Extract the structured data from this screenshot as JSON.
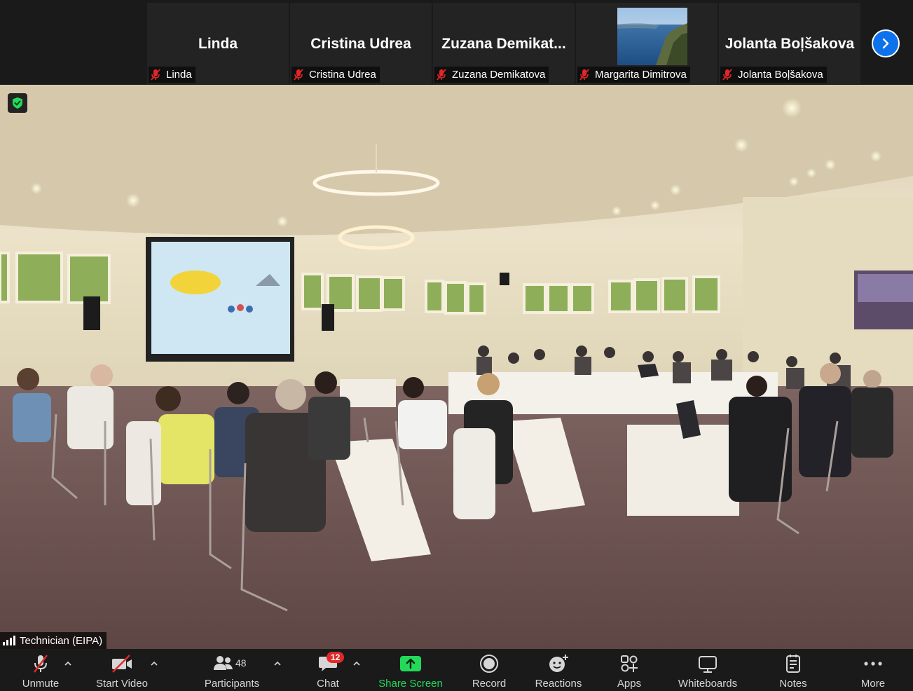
{
  "gallery": {
    "tiles": [
      {
        "big_name": "Linda",
        "label": "Linda"
      },
      {
        "big_name": "Cristina Udrea",
        "label": "Cristina Udrea"
      },
      {
        "big_name": "Zuzana  Demikat...",
        "label": "Zuzana Demikatova"
      },
      {
        "big_name": "",
        "label": "Margarita Dimitrova"
      },
      {
        "big_name": "Jolanta Boļšakova",
        "label": "Jolanta Boļšakova"
      }
    ]
  },
  "main": {
    "speaker_label": "Technician (EIPA)"
  },
  "toolbar": {
    "unmute": "Unmute",
    "start_video": "Start Video",
    "participants": "Participants",
    "participants_count": "48",
    "chat": "Chat",
    "chat_badge": "12",
    "share_screen": "Share Screen",
    "record": "Record",
    "reactions": "Reactions",
    "apps": "Apps",
    "whiteboards": "Whiteboards",
    "notes": "Notes",
    "more": "More"
  },
  "colors": {
    "accent_blue": "#0e72ed",
    "share_green": "#23d959",
    "muted_red": "#e02828",
    "background": "#1a1a1a"
  }
}
